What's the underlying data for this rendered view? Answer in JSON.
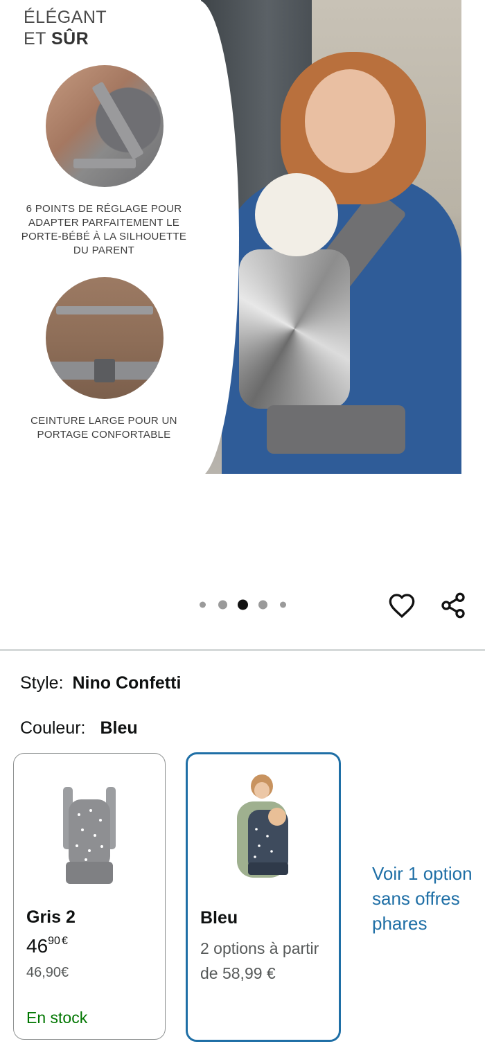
{
  "hero": {
    "title_line1": "ÉLÉGANT",
    "title_line2_prefix": "ET ",
    "title_line2_bold": "SÛR",
    "caption_1": "6 POINTS DE RÉGLAGE POUR ADAPTER PARFAITEMENT LE PORTE-BÉBÉ À LA SILHOUETTE DU PARENT",
    "caption_2": "CEINTURE LARGE POUR UN PORTAGE CONFORTABLE"
  },
  "carousel": {
    "total_dots": 5,
    "active_index": 2
  },
  "actions": {
    "favorite_icon": "heart-icon",
    "share_icon": "share-icon"
  },
  "style": {
    "label": "Style:",
    "value": "Nino Confetti"
  },
  "color": {
    "label": "Couleur:",
    "value": "Bleu"
  },
  "swatches": [
    {
      "name": "Gris 2",
      "price_whole": "46",
      "price_fraction": "90",
      "currency": "€",
      "price_text": "46,90€",
      "availability": "En stock",
      "selected": false
    },
    {
      "name": "Bleu",
      "options_text": "2 options à partir de 58,99 €",
      "selected": true
    }
  ],
  "more_options": {
    "line1": "Voir 1 option",
    "line2": "sans offres",
    "line3": "phares"
  },
  "colors": {
    "accent": "#1f6fa6",
    "in_stock": "#007600",
    "divider": "#d5d9d9"
  }
}
